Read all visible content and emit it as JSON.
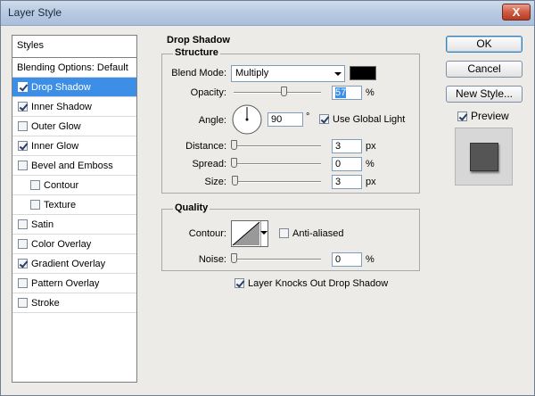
{
  "window": {
    "title": "Layer Style",
    "close_label": "X"
  },
  "styles_panel": {
    "header": "Styles",
    "items": [
      {
        "label": "Blending Options: Default",
        "checked": null,
        "sub": false,
        "selected": false
      },
      {
        "label": "Drop Shadow",
        "checked": true,
        "sub": false,
        "selected": true
      },
      {
        "label": "Inner Shadow",
        "checked": true,
        "sub": false,
        "selected": false
      },
      {
        "label": "Outer Glow",
        "checked": false,
        "sub": false,
        "selected": false
      },
      {
        "label": "Inner Glow",
        "checked": true,
        "sub": false,
        "selected": false
      },
      {
        "label": "Bevel and Emboss",
        "checked": false,
        "sub": false,
        "selected": false
      },
      {
        "label": "Contour",
        "checked": false,
        "sub": true,
        "selected": false
      },
      {
        "label": "Texture",
        "checked": false,
        "sub": true,
        "selected": false
      },
      {
        "label": "Satin",
        "checked": false,
        "sub": false,
        "selected": false
      },
      {
        "label": "Color Overlay",
        "checked": false,
        "sub": false,
        "selected": false
      },
      {
        "label": "Gradient Overlay",
        "checked": true,
        "sub": false,
        "selected": false
      },
      {
        "label": "Pattern Overlay",
        "checked": false,
        "sub": false,
        "selected": false
      },
      {
        "label": "Stroke",
        "checked": false,
        "sub": false,
        "selected": false
      }
    ]
  },
  "drop_shadow": {
    "section_title": "Drop Shadow",
    "structure": {
      "title": "Structure",
      "blend_mode_label": "Blend Mode:",
      "blend_mode_value": "Multiply",
      "shadow_color": "#000000",
      "opacity_label": "Opacity:",
      "opacity_value": "57",
      "opacity_unit": "%",
      "opacity_level": 57,
      "angle_label": "Angle:",
      "angle_value": "90",
      "angle_degrees": 90,
      "angle_unit": "°",
      "use_global_light_label": "Use Global Light",
      "use_global_light": true,
      "distance_label": "Distance:",
      "distance_value": "3",
      "distance_unit": "px",
      "distance_level": 3,
      "spread_label": "Spread:",
      "spread_value": "0",
      "spread_unit": "%",
      "spread_level": 0,
      "size_label": "Size:",
      "size_value": "3",
      "size_unit": "px",
      "size_level": 3
    },
    "quality": {
      "title": "Quality",
      "contour_label": "Contour:",
      "anti_aliased_label": "Anti-aliased",
      "anti_aliased": false,
      "noise_label": "Noise:",
      "noise_value": "0",
      "noise_unit": "%",
      "noise_level": 0
    },
    "layer_knocks_out_label": "Layer Knocks Out Drop Shadow",
    "layer_knocks_out": true
  },
  "buttons": {
    "ok_label": "OK",
    "cancel_label": "Cancel",
    "new_style_label": "New Style...",
    "preview_label": "Preview",
    "preview_checked": true
  },
  "colors": {
    "selection": "#3d8ee7",
    "preview_square": "#555555"
  },
  "icons": {
    "close": "close-icon",
    "dropdown": "chevron-down-icon",
    "angle_dial": "angle-dial-icon",
    "contour_curve": "contour-curve-icon"
  }
}
